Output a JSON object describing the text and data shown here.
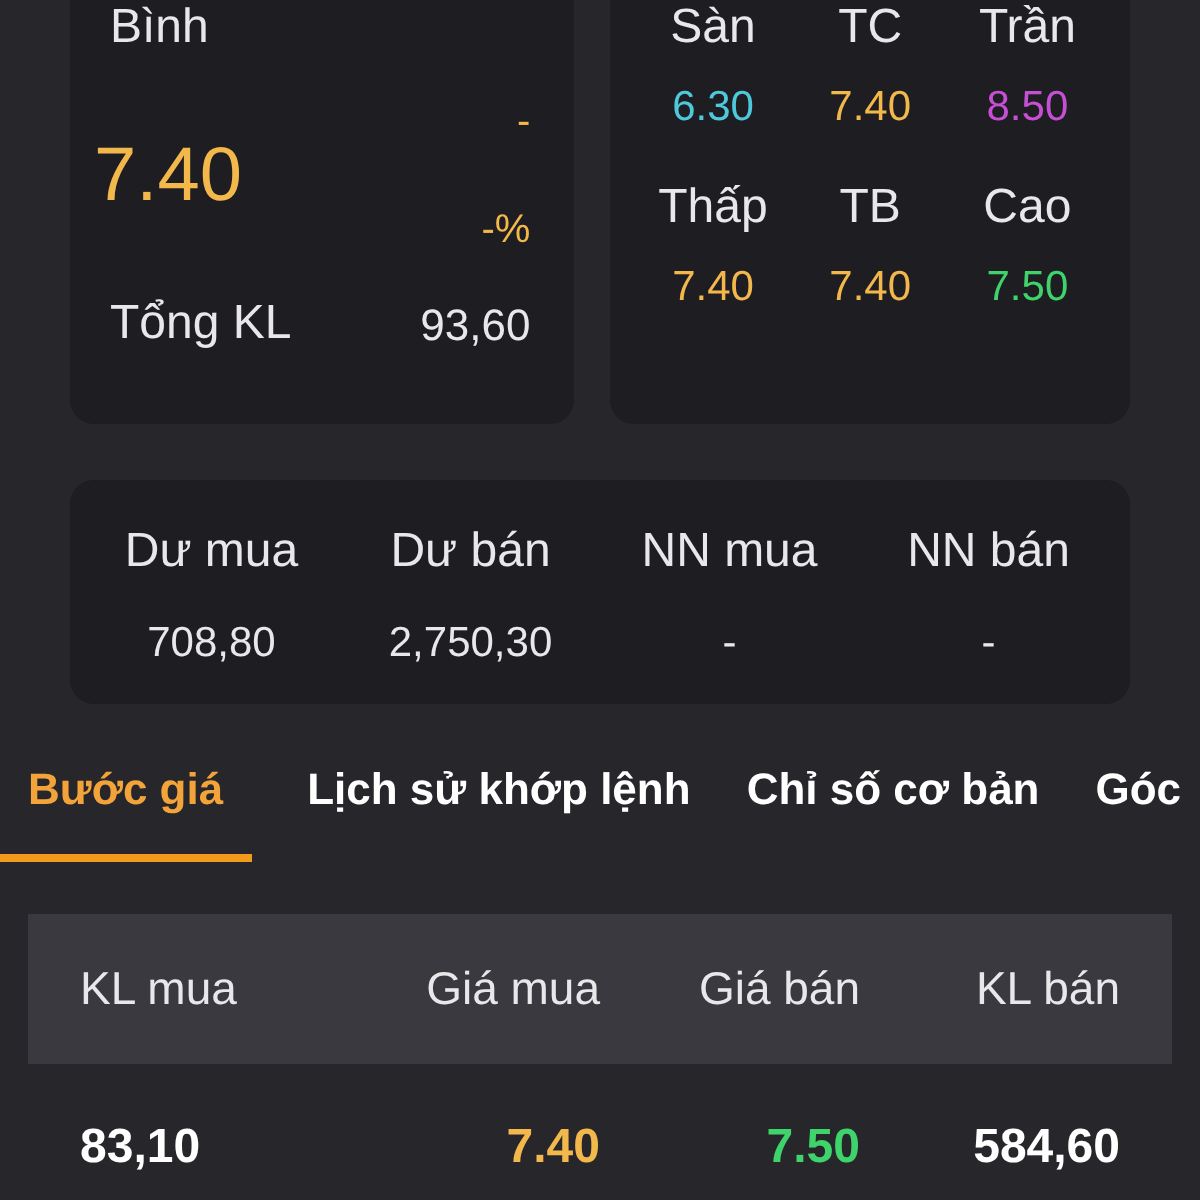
{
  "summary": {
    "status_label": "Bình",
    "price": "7.40",
    "change": "-",
    "change_percent": "-%",
    "volume_label": "Tổng KL",
    "volume": "93,60"
  },
  "price_levels": [
    {
      "label": "Sàn",
      "value": "6.30",
      "color": "#4ec9dc"
    },
    {
      "label": "TC",
      "value": "7.40",
      "color": "#f2b84b"
    },
    {
      "label": "Trần",
      "value": "8.50",
      "color": "#c64fd6"
    },
    {
      "label": "Thấp",
      "value": "7.40",
      "color": "#f2b84b"
    },
    {
      "label": "TB",
      "value": "7.40",
      "color": "#f2b84b"
    },
    {
      "label": "Cao",
      "value": "7.50",
      "color": "#3fd46b"
    }
  ],
  "depth_stats": [
    {
      "label": "Dư mua",
      "value": "708,80"
    },
    {
      "label": "Dư bán",
      "value": "2,750,30"
    },
    {
      "label": "NN mua",
      "value": "-"
    },
    {
      "label": "NN bán",
      "value": "-"
    }
  ],
  "tabs": [
    {
      "label": "Bước giá",
      "selected": true
    },
    {
      "label": "Lịch sử khớp lệnh",
      "selected": false
    },
    {
      "label": "Chỉ số cơ bản",
      "selected": false
    },
    {
      "label": "Góc",
      "selected": false
    }
  ],
  "order_book": {
    "columns": [
      "KL mua",
      "Giá mua",
      "Giá bán",
      "KL bán"
    ],
    "rows": [
      {
        "bid_volume": "83,10",
        "bid_price": "7.40",
        "ask_price": "7.50",
        "ask_volume": "584,60"
      }
    ]
  }
}
